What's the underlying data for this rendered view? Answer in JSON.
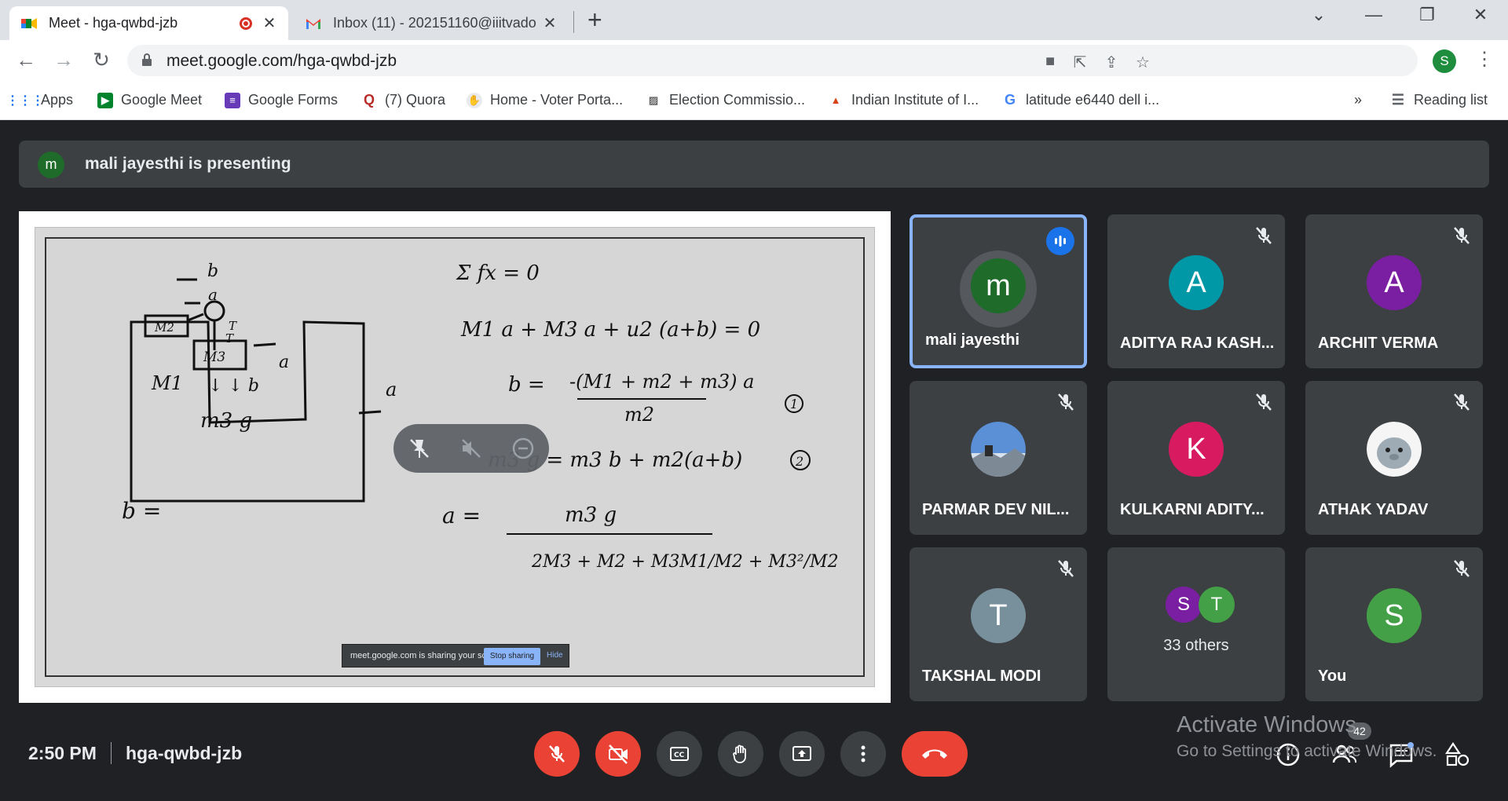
{
  "tabs": [
    {
      "title": "Meet - hga-qwbd-jzb",
      "icon": "meet-icon",
      "recording": true
    },
    {
      "title": "Inbox (11) - 202151160@iiitvado",
      "icon": "gmail-icon"
    }
  ],
  "address": {
    "url": "meet.google.com/hga-qwbd-jzb"
  },
  "profile_initial": "S",
  "bookmarks": [
    {
      "label": "Apps",
      "icon": "apps-grid-icon"
    },
    {
      "label": "Google Meet",
      "icon": "meet-icon"
    },
    {
      "label": "Google Forms",
      "icon": "forms-icon"
    },
    {
      "label": "(7) Quora",
      "icon": "quora-icon"
    },
    {
      "label": "Home - Voter Porta...",
      "icon": "voter-portal-icon"
    },
    {
      "label": "Election Commissio...",
      "icon": "election-commission-icon"
    },
    {
      "label": "Indian Institute of I...",
      "icon": "institute-icon"
    },
    {
      "label": "latitude e6440 dell i...",
      "icon": "google-icon"
    }
  ],
  "reading_list": "Reading list",
  "overflow_chevron": "»",
  "presenting": {
    "initial": "m",
    "text": "mali jayesthi is presenting"
  },
  "whiteboard": {
    "left": {
      "b_top": "b",
      "a_top": "a",
      "m2": "M2",
      "t1": "T",
      "t2": "T",
      "m3": "M3",
      "a_right": "a",
      "m1": "M1",
      "arrows_b": "↓ ↓ b",
      "a_out": "a",
      "m3g": "m3 g",
      "b_eq": "b ="
    },
    "eqs": {
      "e1": "Σ fx = 0",
      "e2": "M1 a + M3 a + u2 (a+b) = 0",
      "e3_lhs": "b =",
      "e3_num": "-(M1 + m2 + m3) a",
      "e3_den": "m2",
      "e3_tag": "1",
      "e4": "m3 g = m3 b + m2(a+b)",
      "e4_tag": "2",
      "e5_lhs": "a =",
      "e5_num": "m3 g",
      "e5_den": "2M3 + M2 + M3M1/M2 + M3²/M2"
    }
  },
  "share_notice": {
    "text": "meet.google.com is sharing your screen.",
    "stop": "Stop sharing",
    "hide": "Hide"
  },
  "participants": [
    {
      "name": "mali jayesthi",
      "initial": "m",
      "color": "#1e6b2a",
      "speaking": true
    },
    {
      "name": "ADITYA RAJ KASH...",
      "initial": "A",
      "color": "#0097a7"
    },
    {
      "name": "ARCHIT VERMA",
      "initial": "A",
      "color": "#7b1fa2"
    },
    {
      "name": "PARMAR DEV NIL...",
      "initial": "",
      "color": "#4a90d9",
      "photo": "mountain-avatar"
    },
    {
      "name": "KULKARNI ADITY...",
      "initial": "K",
      "color": "#d81b60"
    },
    {
      "name": "ATHAK YADAV",
      "initial": "",
      "color": "#cfd8dc",
      "photo": "seal-avatar"
    },
    {
      "name": "TAKSHAL MODI",
      "initial": "T",
      "color": "#78909c"
    },
    {
      "name": "33 others",
      "mini": [
        {
          "initial": "S",
          "color": "#7b1fa2"
        },
        {
          "initial": "T",
          "color": "#43a047"
        }
      ]
    },
    {
      "name": "You",
      "initial": "S",
      "color": "#43a047"
    }
  ],
  "footer": {
    "time": "2:50 PM",
    "meeting_code": "hga-qwbd-jzb"
  },
  "people_count": "42",
  "watermark": {
    "line1": "Activate Windows",
    "line2": "Go to Settings to activate Windows."
  }
}
